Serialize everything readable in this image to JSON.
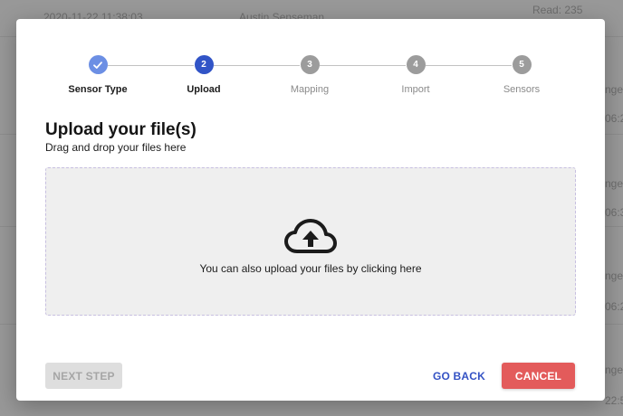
{
  "background": {
    "row_timestamp": "2020-11-22 11:38:03",
    "row_user": "Austin Senseman",
    "row_read": "Read: 235",
    "side_fragments": [
      "nge:",
      "06:2",
      "nge:",
      "06:3",
      "nge:",
      "06:2",
      "nge:",
      "22:5"
    ]
  },
  "stepper": {
    "steps": [
      {
        "number": "1",
        "label": "Sensor Type",
        "state": "done"
      },
      {
        "number": "2",
        "label": "Upload",
        "state": "active"
      },
      {
        "number": "3",
        "label": "Mapping",
        "state": "todo"
      },
      {
        "number": "4",
        "label": "Import",
        "state": "todo"
      },
      {
        "number": "5",
        "label": "Sensors",
        "state": "todo"
      }
    ]
  },
  "content": {
    "title": "Upload your file(s)",
    "subtitle": "Drag and drop your files here",
    "dropzone_text": "You can also upload your files by clicking here",
    "dropzone_icon": "cloud-upload-icon"
  },
  "footer": {
    "next_label": "NEXT STEP",
    "back_label": "GO BACK",
    "cancel_label": "CANCEL"
  },
  "colors": {
    "done": "#6c8fe4",
    "active": "#3154c7",
    "todo": "#9c9c9c",
    "link": "#3452c4",
    "danger": "#e35b5b"
  }
}
